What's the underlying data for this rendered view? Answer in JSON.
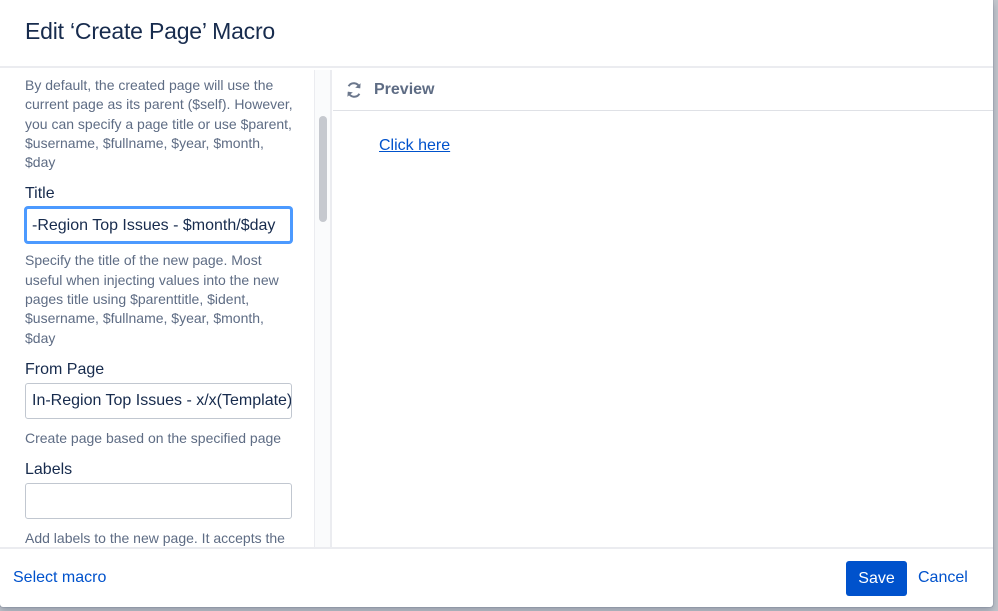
{
  "dialog": {
    "title": "Edit ‘Create Page’ Macro"
  },
  "form": {
    "parent_help": "By default, the created page will use the current page as its parent ($self). However, you can specify a page title or use $parent, $username, $fullname, $year, $month, $day",
    "title_label": "Title",
    "title_value": "-Region Top Issues - $month/$day",
    "title_help": "Specify the title of the new page. Most useful when injecting values into the new pages title using $parenttitle, $ident, $username, $fullname, $year, $month, $day",
    "from_page_label": "From Page",
    "from_page_value": "In-Region Top Issues - x/x(Template)",
    "from_page_help": "Create page based on the specified page",
    "labels_label": "Labels",
    "labels_value": "",
    "labels_help": "Add labels to the new page. It accepts the injected values $parenttitle,"
  },
  "preview": {
    "header": "Preview",
    "refresh_icon": "refresh-icon",
    "link_text": "Click here"
  },
  "footer": {
    "select_macro": "Select macro",
    "save": "Save",
    "cancel": "Cancel"
  },
  "colors": {
    "primary": "#0052cc",
    "focus": "#4c9aff",
    "title_text": "#172b4d",
    "help_text": "#5e6c84"
  }
}
